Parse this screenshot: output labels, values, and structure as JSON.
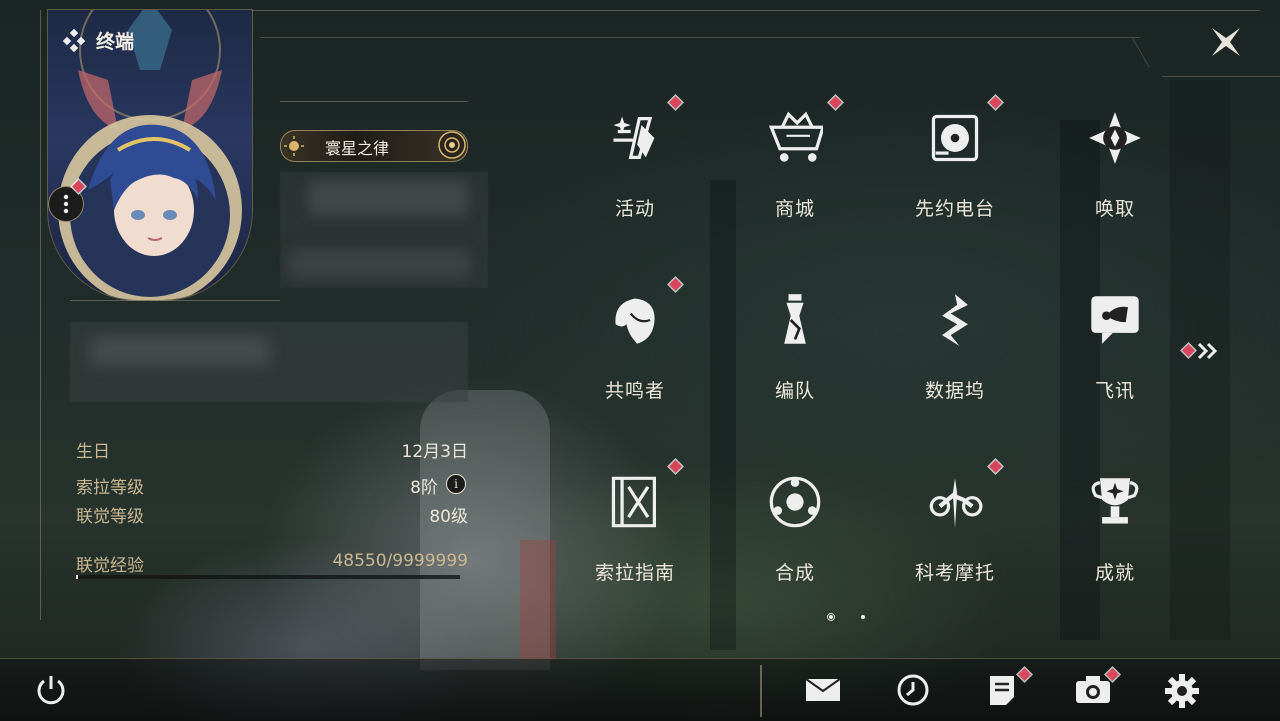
{
  "header": {
    "title": "终端"
  },
  "profile": {
    "title_badge": "寰星之律",
    "stats": [
      {
        "label": "生日",
        "value": "12月3日"
      },
      {
        "label": "索拉等级",
        "value": "8阶"
      },
      {
        "label": "联觉等级",
        "value": "80级"
      }
    ],
    "exp": {
      "label": "联觉经验",
      "value": "48550/9999999",
      "progress": 0.0049
    }
  },
  "menu": {
    "items": [
      {
        "label": "活动",
        "icon": "activity-icon",
        "badge": true
      },
      {
        "label": "商城",
        "icon": "shop-cart-icon",
        "badge": true
      },
      {
        "label": "先约电台",
        "icon": "radio-pass-icon",
        "badge": true
      },
      {
        "label": "唤取",
        "icon": "convene-compass-icon",
        "badge": false
      },
      {
        "label": "共鸣者",
        "icon": "resonator-icon",
        "badge": true
      },
      {
        "label": "编队",
        "icon": "team-chess-icon",
        "badge": false
      },
      {
        "label": "数据坞",
        "icon": "data-bank-icon",
        "badge": false
      },
      {
        "label": "飞讯",
        "icon": "chat-icon",
        "badge": false
      },
      {
        "label": "索拉指南",
        "icon": "guidebook-icon",
        "badge": true
      },
      {
        "label": "合成",
        "icon": "synthesis-icon",
        "badge": false
      },
      {
        "label": "科考摩托",
        "icon": "motorbike-icon",
        "badge": true
      },
      {
        "label": "成就",
        "icon": "trophy-icon",
        "badge": false
      }
    ],
    "page_indicator": {
      "current": 1,
      "total": 2
    }
  },
  "bottom_bar": {
    "icons": [
      "power-icon",
      "mail-icon",
      "clock-icon",
      "notes-icon",
      "camera-icon",
      "settings-icon"
    ]
  },
  "colors": {
    "accent_gold": "#c9b892",
    "badge_red": "#d9455a",
    "text": "#ece6da"
  }
}
